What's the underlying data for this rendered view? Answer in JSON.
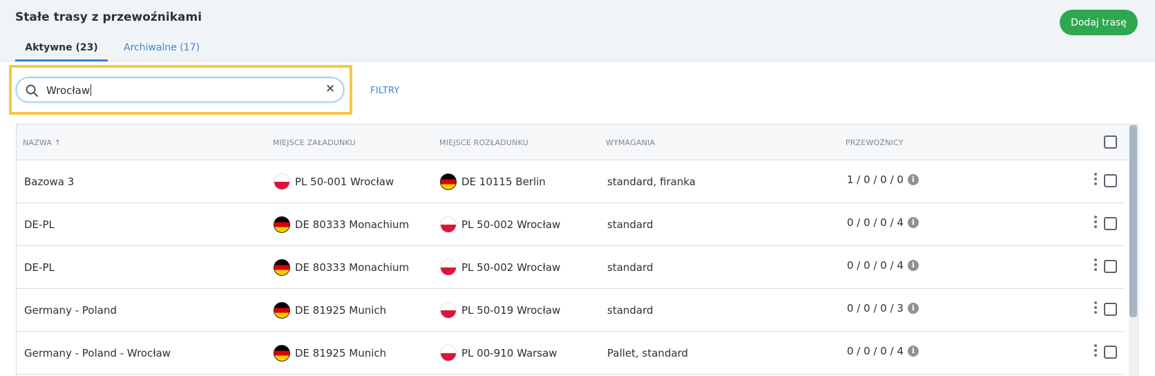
{
  "header": {
    "title": "Stałe trasy z przewoźnikami",
    "add_button": "Dodaj trasę",
    "tabs": [
      {
        "label": "Aktywne (23)",
        "active": true
      },
      {
        "label": "Archiwalne (17)",
        "active": false
      }
    ]
  },
  "search": {
    "value": "Wrocław",
    "filters_label": "FILTRY"
  },
  "table": {
    "columns": {
      "name": "NAZWA ↑",
      "loading": "MIEJSCE ZAŁADUNKU",
      "unloading": "MIEJSCE ROZŁADUNKU",
      "requirements": "WYMAGANIA",
      "carriers": "PRZEWOŹNICY"
    },
    "rows": [
      {
        "name": "Bazowa 3",
        "loading_flag": "pl",
        "loading": "PL 50-001 Wrocław",
        "unloading_flag": "de",
        "unloading": "DE 10115 Berlin",
        "requirements": "standard, firanka",
        "carriers": "1 / 0 / 0 / 0"
      },
      {
        "name": "DE-PL",
        "loading_flag": "de",
        "loading": "DE 80333 Monachium",
        "unloading_flag": "pl",
        "unloading": "PL 50-002 Wrocław",
        "requirements": "standard",
        "carriers": "0 / 0 / 0 / 4"
      },
      {
        "name": "DE-PL",
        "loading_flag": "de",
        "loading": "DE 80333 Monachium",
        "unloading_flag": "pl",
        "unloading": "PL 50-002 Wrocław",
        "requirements": "standard",
        "carriers": "0 / 0 / 0 / 4"
      },
      {
        "name": "Germany - Poland",
        "loading_flag": "de",
        "loading": "DE 81925 Munich",
        "unloading_flag": "pl",
        "unloading": "PL 50-019 Wrocław",
        "requirements": "standard",
        "carriers": "0 / 0 / 0 / 3"
      },
      {
        "name": "Germany - Poland - Wrocław",
        "loading_flag": "de",
        "loading": "DE 81925 Munich",
        "unloading_flag": "pl",
        "unloading": "PL 00-910 Warsaw",
        "requirements": "Pallet, standard",
        "carriers": "0 / 0 / 0 / 4"
      }
    ]
  },
  "colors": {
    "accent": "#3a86d8",
    "add_button": "#2ea84f",
    "search_highlight": "#f5c842"
  }
}
